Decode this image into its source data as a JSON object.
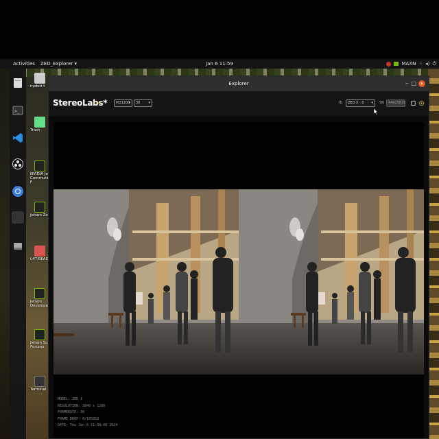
{
  "topbar": {
    "activities": "Activities",
    "app_name": "ZED_Explorer ▾",
    "clock": "Jan 6 11:59",
    "power_mode": "MAXN",
    "tray_icons": [
      "nvidia-update-icon",
      "nvidia-power-icon",
      "network-icon",
      "volume-icon",
      "power-icon"
    ]
  },
  "dock": {
    "items": [
      "files-icon",
      "terminal-icon",
      "vscode-icon",
      "obs-icon",
      "chromium-icon",
      "blank-app-icon",
      "drive-icon"
    ]
  },
  "desktop_icons": [
    {
      "label": "inpbot t",
      "icon": "file"
    },
    {
      "label": "Trash",
      "icon": "trash"
    },
    {
      "label": "NVIDIA Jets Community F",
      "icon": "nvidia"
    },
    {
      "label": "Jetson Zoo",
      "icon": "nvidia"
    },
    {
      "label": "L4T-README",
      "icon": "folder"
    },
    {
      "label": "Jetson Developer Z",
      "icon": "nvidia"
    },
    {
      "label": "Jetson Supp Forums",
      "icon": "nvidia"
    },
    {
      "label": "Terminal",
      "icon": "terminal"
    }
  ],
  "window": {
    "title": "Explorer",
    "controls": [
      "–",
      "□",
      "×"
    ]
  },
  "toolbar": {
    "brand": "StereoLabs*",
    "live_label": "LIVE",
    "resolution_value": "HD1200",
    "fps_value": "30",
    "id_label": "ID",
    "camera_value": "ZED X - 0",
    "sn_label": "SN",
    "sn_value": "44620836"
  },
  "info": {
    "model": "MODEL: ZED X",
    "resolution": "RESOLUTION: 3840 x 1200",
    "framerate": "FRAMERATE: 30",
    "frame_drop": "FRAME DROP: 0/105858",
    "date": "DATE: Thu Jan 6 11:58:08 2024"
  }
}
